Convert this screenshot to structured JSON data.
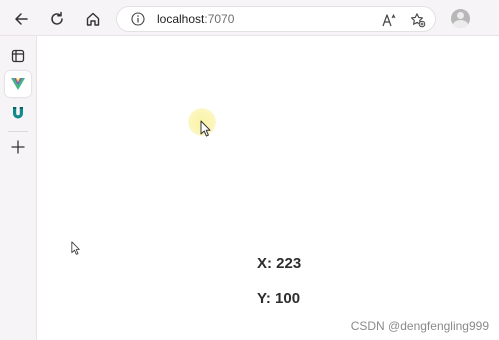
{
  "browser": {
    "url_host": "localhost",
    "url_port": ":7070"
  },
  "page": {
    "x_label": "X: 223",
    "y_label": "Y: 100"
  },
  "watermark": "CSDN @dengfengling999",
  "colors": {
    "chrome_bg": "#f7f4f7",
    "highlight": "#faf2a0",
    "text": "#2d2d2d"
  },
  "icons": [
    "back-icon",
    "refresh-icon",
    "home-icon",
    "info-icon",
    "read-aloud-icon",
    "favorites-icon",
    "profile-icon",
    "tab-actions-icon",
    "vue-devtools-icon",
    "extension-u-icon",
    "add-icon"
  ]
}
